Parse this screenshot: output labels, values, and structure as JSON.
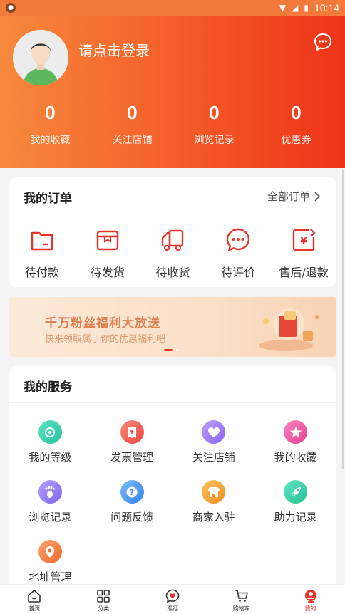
{
  "status_bar": {
    "time": "10:14"
  },
  "header": {
    "login_prompt": "请点击登录",
    "stats": [
      {
        "value": "0",
        "label": "我的收藏"
      },
      {
        "value": "0",
        "label": "关注店铺"
      },
      {
        "value": "0",
        "label": "浏览记录"
      },
      {
        "value": "0",
        "label": "优惠券"
      }
    ]
  },
  "orders": {
    "title": "我的订单",
    "all_link": "全部订单",
    "items": [
      {
        "label": "待付款",
        "icon": "wallet-icon"
      },
      {
        "label": "待发货",
        "icon": "box-icon"
      },
      {
        "label": "待收货",
        "icon": "truck-icon"
      },
      {
        "label": "待评价",
        "icon": "chat-icon"
      },
      {
        "label": "售后/退款",
        "icon": "refund-icon"
      }
    ]
  },
  "banner": {
    "title": "千万粉丝福利大放送",
    "subtitle": "快来领取属于你的优惠福利吧"
  },
  "services": {
    "title": "我的服务",
    "items": [
      {
        "label": "我的等级",
        "icon": "level-icon",
        "color": "#3fd1b0"
      },
      {
        "label": "发票管理",
        "icon": "invoice-icon",
        "color": "#f0645a"
      },
      {
        "label": "关注店铺",
        "icon": "heart-icon",
        "color": "#a17cf5"
      },
      {
        "label": "我的收藏",
        "icon": "star-icon",
        "color": "#f25fa8"
      },
      {
        "label": "浏览记录",
        "icon": "footprint-icon",
        "color": "#9b82f0"
      },
      {
        "label": "问题反馈",
        "icon": "question-icon",
        "color": "#4a9cf2"
      },
      {
        "label": "商家入驻",
        "icon": "shop-icon",
        "color": "#f5a336"
      },
      {
        "label": "助力记录",
        "icon": "rocket-icon",
        "color": "#2fcfa4"
      },
      {
        "label": "地址管理",
        "icon": "location-icon",
        "color": "#f5874a"
      }
    ]
  },
  "tabbar": {
    "items": [
      {
        "label": "首页",
        "icon": "home-icon"
      },
      {
        "label": "分类",
        "icon": "grid-icon"
      },
      {
        "label": "逛逛",
        "icon": "heart-bubble-icon"
      },
      {
        "label": "购物车",
        "icon": "cart-icon"
      },
      {
        "label": "我的",
        "icon": "profile-icon",
        "active": true
      }
    ],
    "accent": "#e5342a"
  }
}
